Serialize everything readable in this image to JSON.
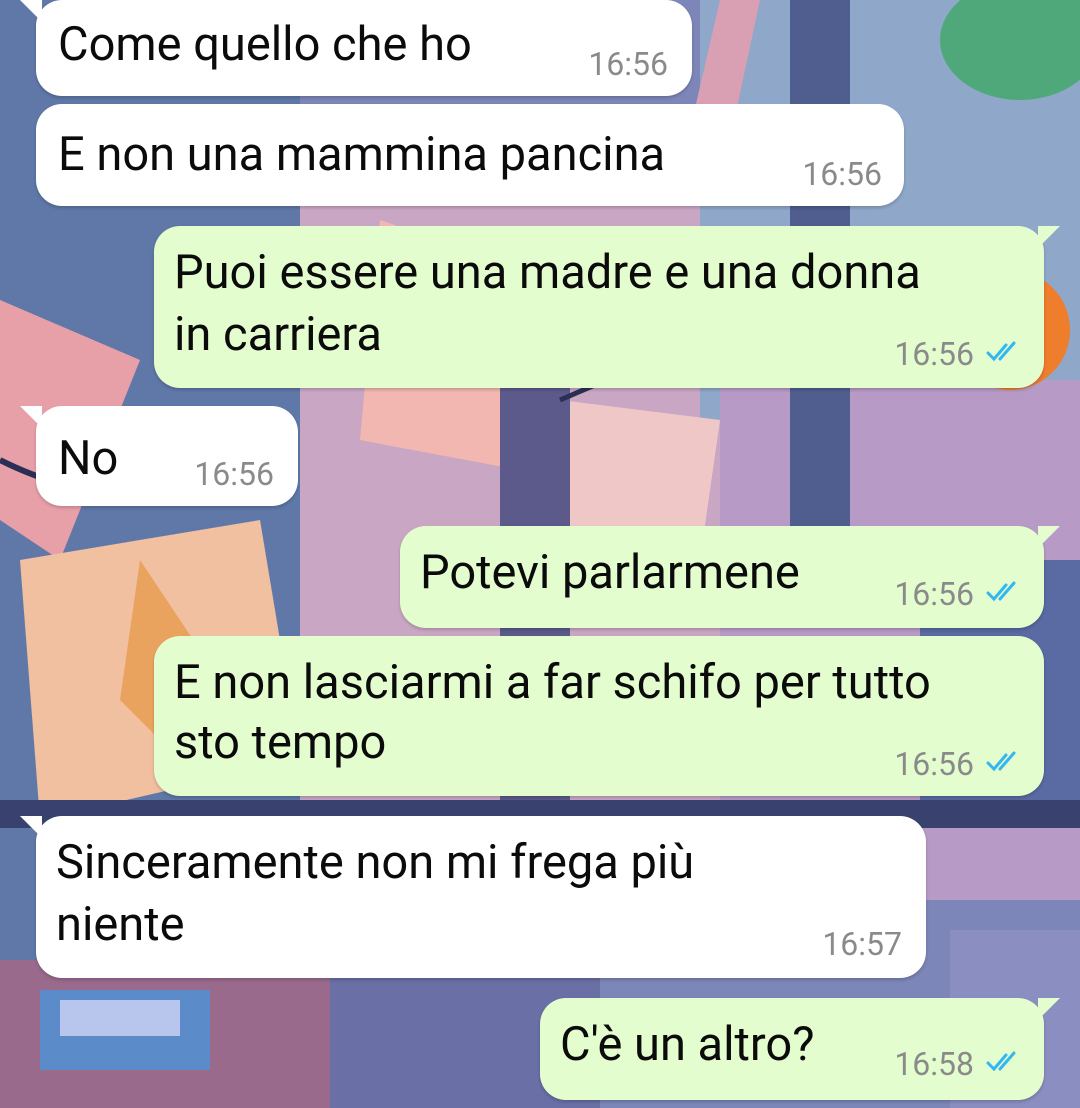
{
  "colors": {
    "incoming_bubble": "#ffffff",
    "outgoing_bubble": "#e4fdcf",
    "text": "#0b0b0b",
    "timestamp": "#8a8a8a",
    "read_ticks": "#34b7f1"
  },
  "messages": [
    {
      "direction": "incoming",
      "lines": [
        "Come quello che ho"
      ],
      "time": "16:56"
    },
    {
      "direction": "incoming",
      "lines": [
        "E non una mammina pancina"
      ],
      "time": "16:56"
    },
    {
      "direction": "outgoing",
      "lines": [
        "Puoi essere una madre e una donna",
        "in carriera"
      ],
      "time": "16:56",
      "status_icon": "double-check-read-icon"
    },
    {
      "direction": "incoming",
      "lines": [
        "No"
      ],
      "time": "16:56"
    },
    {
      "direction": "outgoing",
      "lines": [
        "Potevi parlarmene"
      ],
      "time": "16:56",
      "status_icon": "double-check-read-icon"
    },
    {
      "direction": "outgoing",
      "lines": [
        "E non lasciarmi a far schifo per tutto",
        "sto tempo"
      ],
      "time": "16:56",
      "status_icon": "double-check-read-icon"
    },
    {
      "direction": "incoming",
      "lines": [
        "Sinceramente non mi frega più",
        "niente"
      ],
      "time": "16:57"
    },
    {
      "direction": "outgoing",
      "lines": [
        "C'è un altro?"
      ],
      "time": "16:58",
      "status_icon": "double-check-read-icon"
    }
  ]
}
